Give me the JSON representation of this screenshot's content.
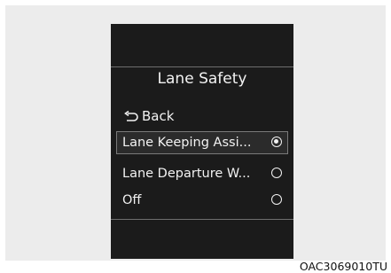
{
  "screen": {
    "title": "Lane Safety",
    "back_label": "Back",
    "options": [
      {
        "label": "Lane Keeping Assi...",
        "selected": true
      },
      {
        "label": "Lane Departure W...",
        "selected": false
      },
      {
        "label": "Off",
        "selected": false
      }
    ]
  },
  "figure_code": "OAC3069010TU"
}
